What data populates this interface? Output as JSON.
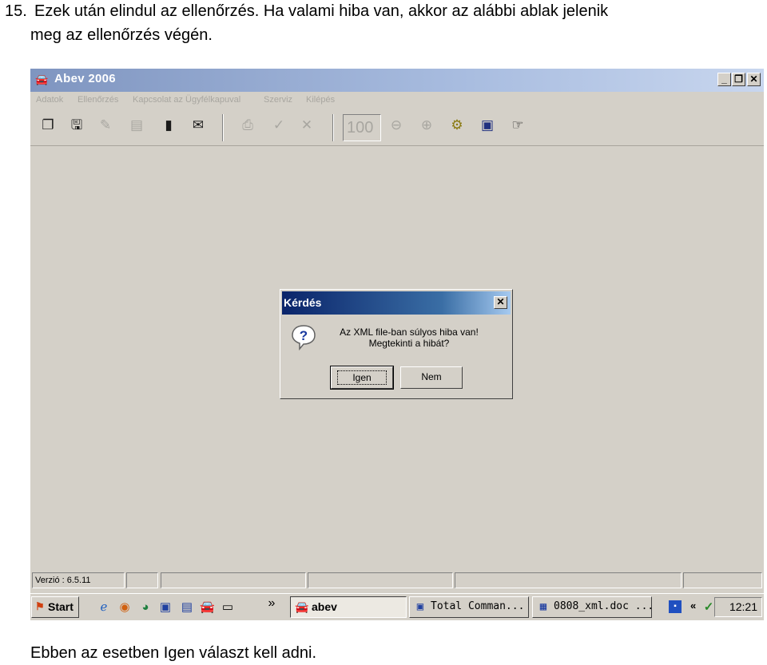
{
  "document": {
    "step_number": "15.",
    "step_text_line1": "Ezek után elindul az ellenőrzés. Ha valami hiba van, akkor az alábbi ablak jelenik",
    "step_text_line2": "meg az ellenőrzés végén.",
    "footer_text": "Ebben az esetben Igen választ kell adni."
  },
  "window": {
    "title": "Abev 2006",
    "controls": {
      "minimize": "_",
      "restore": "❐",
      "close": "✕"
    },
    "menu": [
      "Adatok",
      "Ellenőrzés",
      "Kapcsolat az Ügyfélkapuval",
      "Szerviz",
      "Kilépés"
    ],
    "zoom_value": "100",
    "status_version": "Verzió : 6.5.11"
  },
  "dialog": {
    "title": "Kérdés",
    "close_glyph": "✕",
    "message_line1": "Az XML file-ban súlyos hiba van!",
    "message_line2": "Megtekinti a hibát?",
    "yes_label": "Igen",
    "no_label": "Nem"
  },
  "taskbar": {
    "start_label": "Start",
    "chevron": "»",
    "active_task": "abev",
    "tasks": [
      "Total Comman...",
      "0808_xml.doc ..."
    ],
    "tray_extra": "«",
    "clock": "12:21"
  },
  "icons": {
    "toolbar": [
      "open-icon",
      "save-icon",
      "edit-icon",
      "print-preview-icon",
      "book-icon",
      "mail-icon",
      "print-icon",
      "check-icon",
      "cancel-icon",
      "zoom-out-icon",
      "zoom-in-icon",
      "gears-icon",
      "calculator-icon",
      "pointer-icon"
    ],
    "dialog": "question-icon"
  },
  "colors": {
    "window_bg": "#d4d0c8",
    "app_title_gradient_start": "#7f95c0",
    "dialog_title_gradient_start": "#0a246a",
    "disabled_text": "#a8a6a0"
  }
}
